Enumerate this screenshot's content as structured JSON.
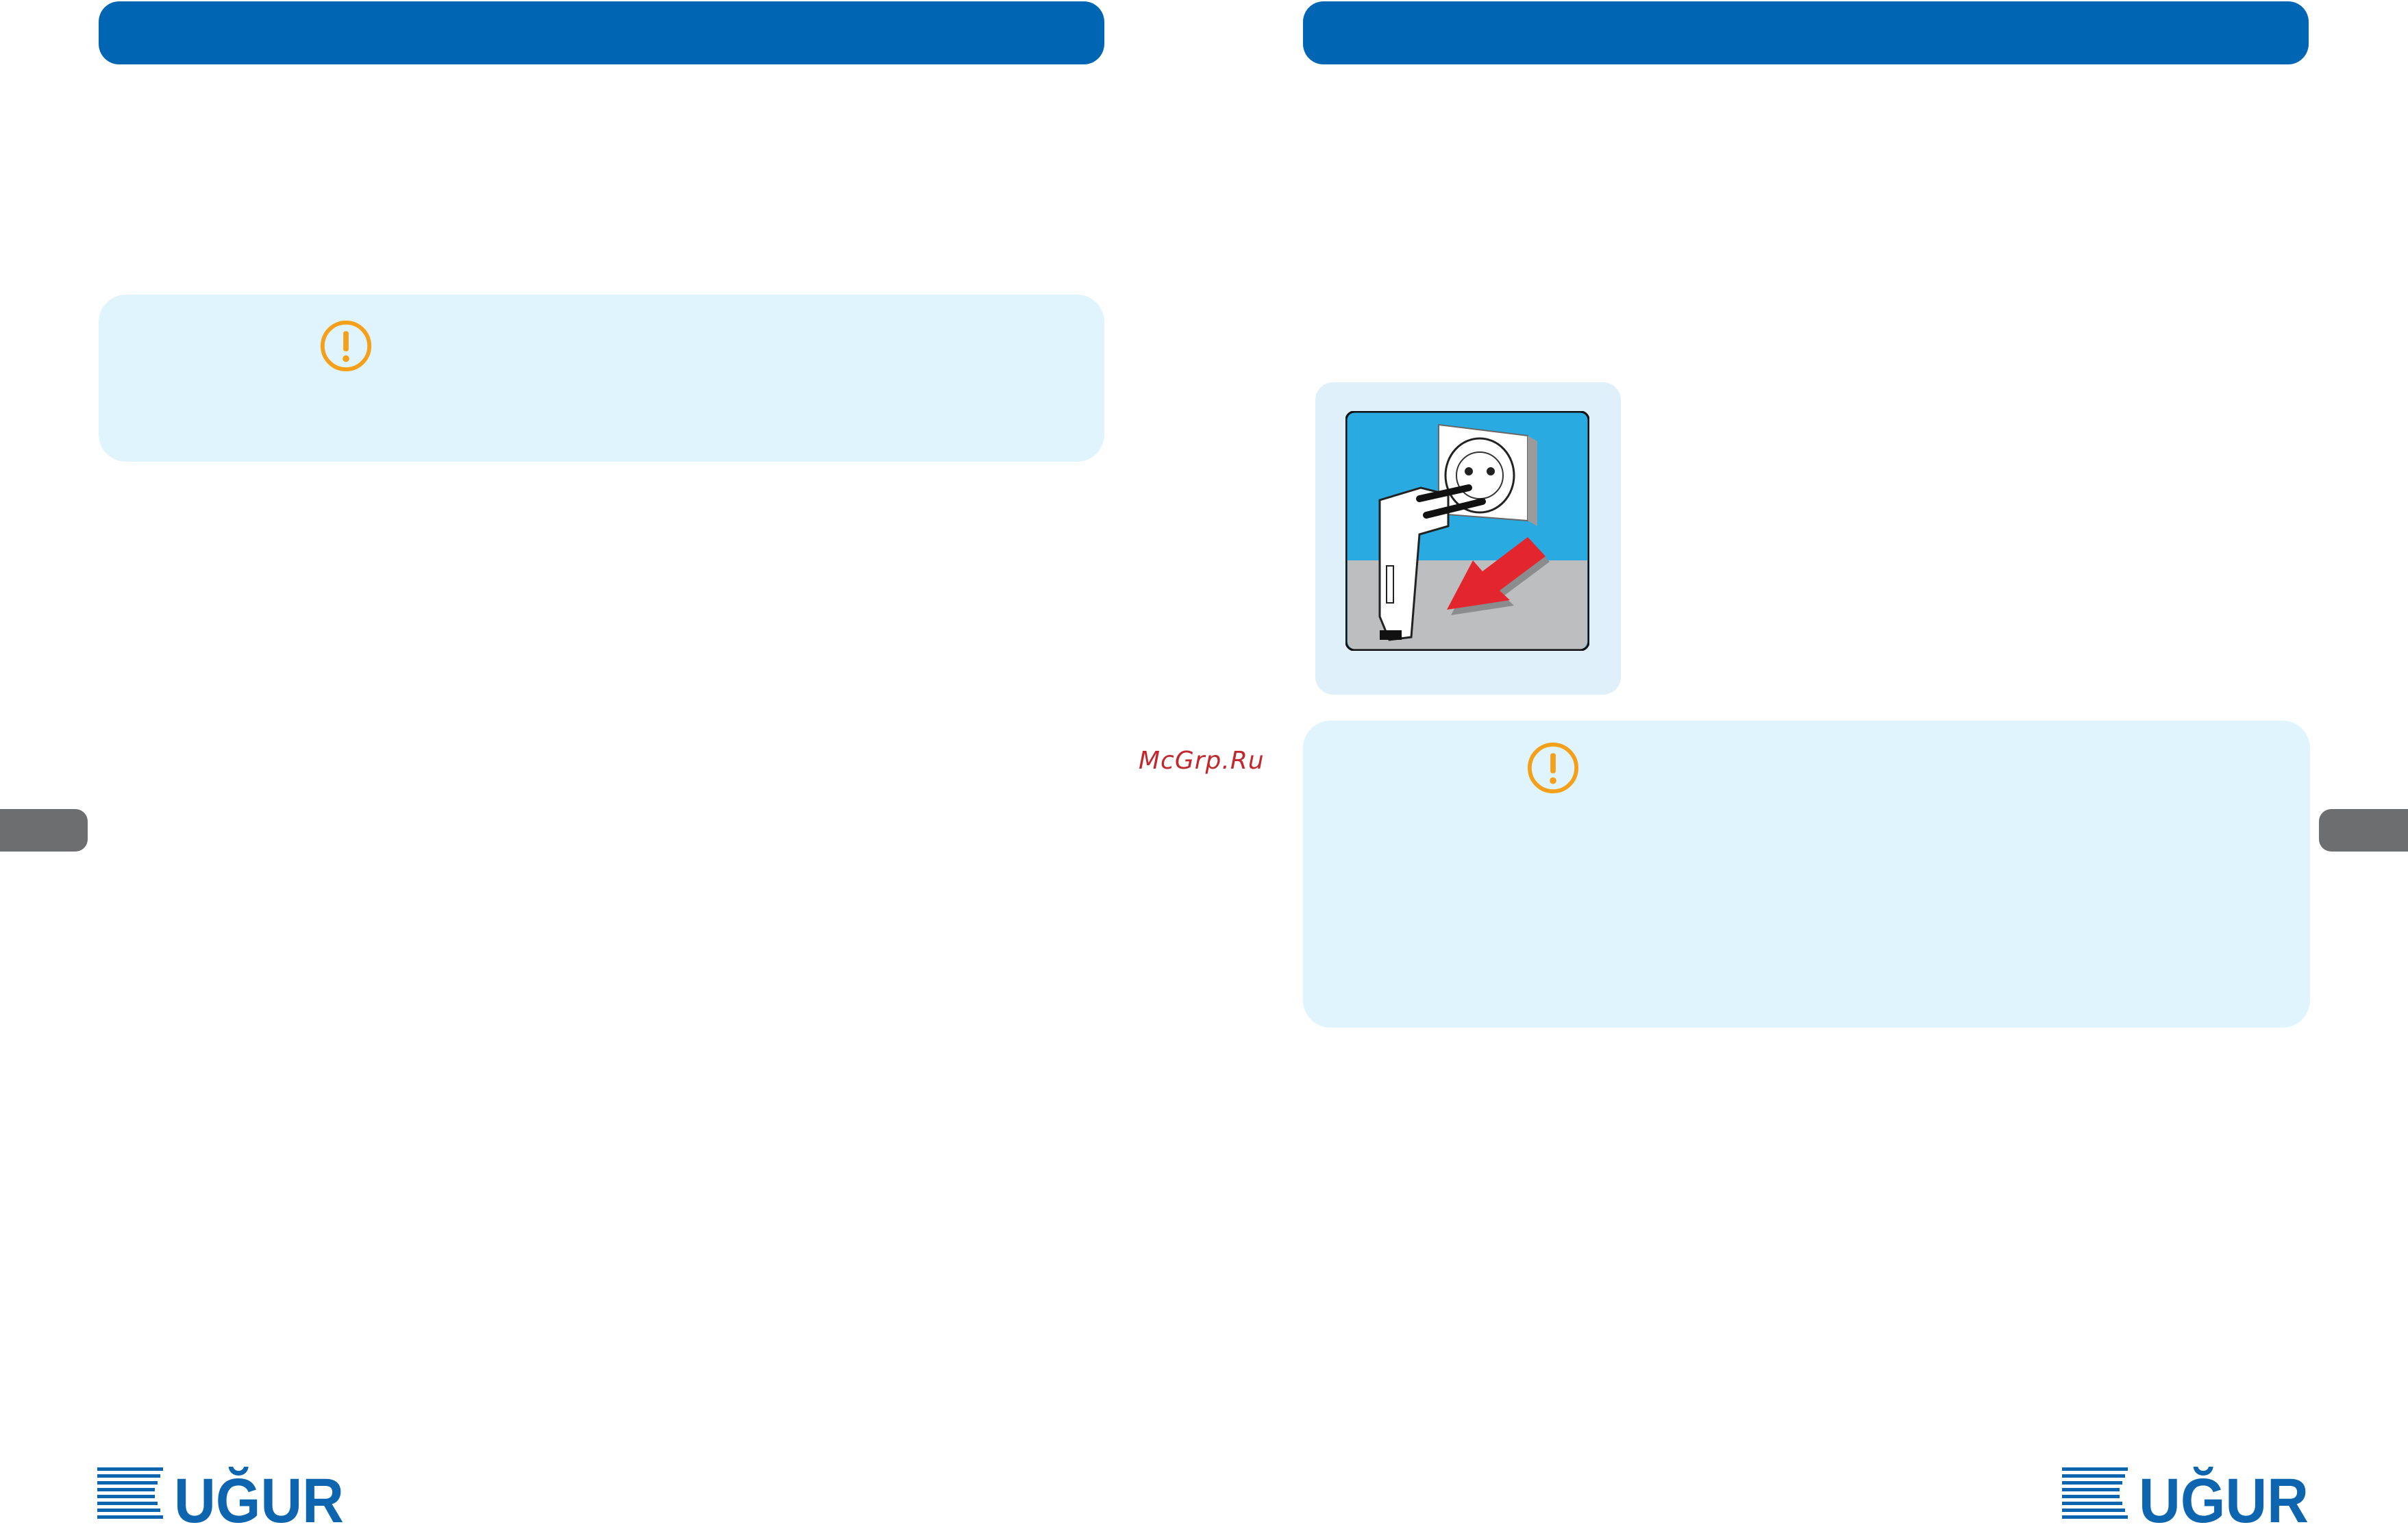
{
  "left_page": {
    "header": {
      "color": "#0066b3"
    },
    "note": {
      "icon": "exclamation-circle-icon",
      "icon_color": "#f5a01a",
      "background": "#e0f4fd"
    },
    "side_tab": {
      "color": "#6d6e70"
    },
    "logo": {
      "text": "UĞUR",
      "color": "#0d65b0"
    }
  },
  "right_page": {
    "header": {
      "color": "#0066b3"
    },
    "figure": {
      "description_icon": "unplug-socket-icon",
      "arrow_color": "#e3262d",
      "wall_color": "#29abe2",
      "floor_color": "#bcbec0"
    },
    "note": {
      "icon": "exclamation-circle-icon",
      "icon_color": "#f5a01a",
      "background": "#e0f4fd"
    },
    "side_tab": {
      "color": "#6d6e70"
    },
    "logo": {
      "text": "UĞUR",
      "color": "#0d65b0"
    }
  },
  "watermark": {
    "text": "McGrp.Ru",
    "color": "#c0282d"
  }
}
